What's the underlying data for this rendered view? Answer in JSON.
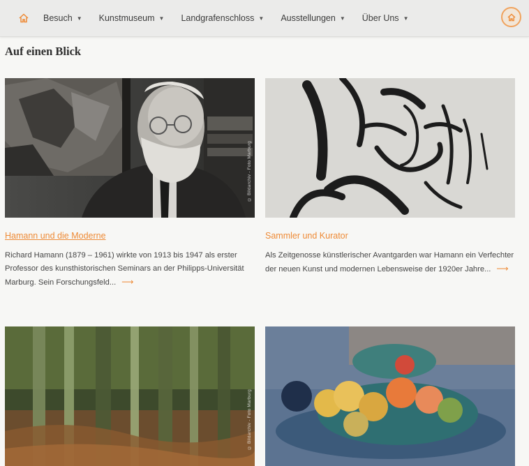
{
  "nav": {
    "home_icon": "home-icon",
    "items": [
      {
        "label": "Besuch"
      },
      {
        "label": "Kunstmuseum"
      },
      {
        "label": "Landgrafenschloss"
      },
      {
        "label": "Ausstellungen"
      },
      {
        "label": "Über Uns"
      }
    ],
    "accent_color": "#ee8a35"
  },
  "section": {
    "title": "Auf einen Blick"
  },
  "cards": [
    {
      "title": "Hamann und die Moderne",
      "text": "Richard Hamann (1879 – 1961) wirkte von 1913 bis 1947 als erster Professor des kunsthistorischen Seminars an der Philipps-Universität Marburg. Sein Forschungsfeld...",
      "credit": "© Bildarchiv - Foto Marburg"
    },
    {
      "title": "Sammler und Kurator",
      "text": "Als Zeitgenosse künstlerischer Avantgarden war Hamann ein Verfechter der neuen Kunst und modernen Lebensweise der 1920er Jahre...",
      "credit": ""
    },
    {
      "title": "",
      "text": "",
      "credit": "© Bildarchiv - Foto Marburg"
    },
    {
      "title": "",
      "text": "",
      "credit": ""
    }
  ]
}
